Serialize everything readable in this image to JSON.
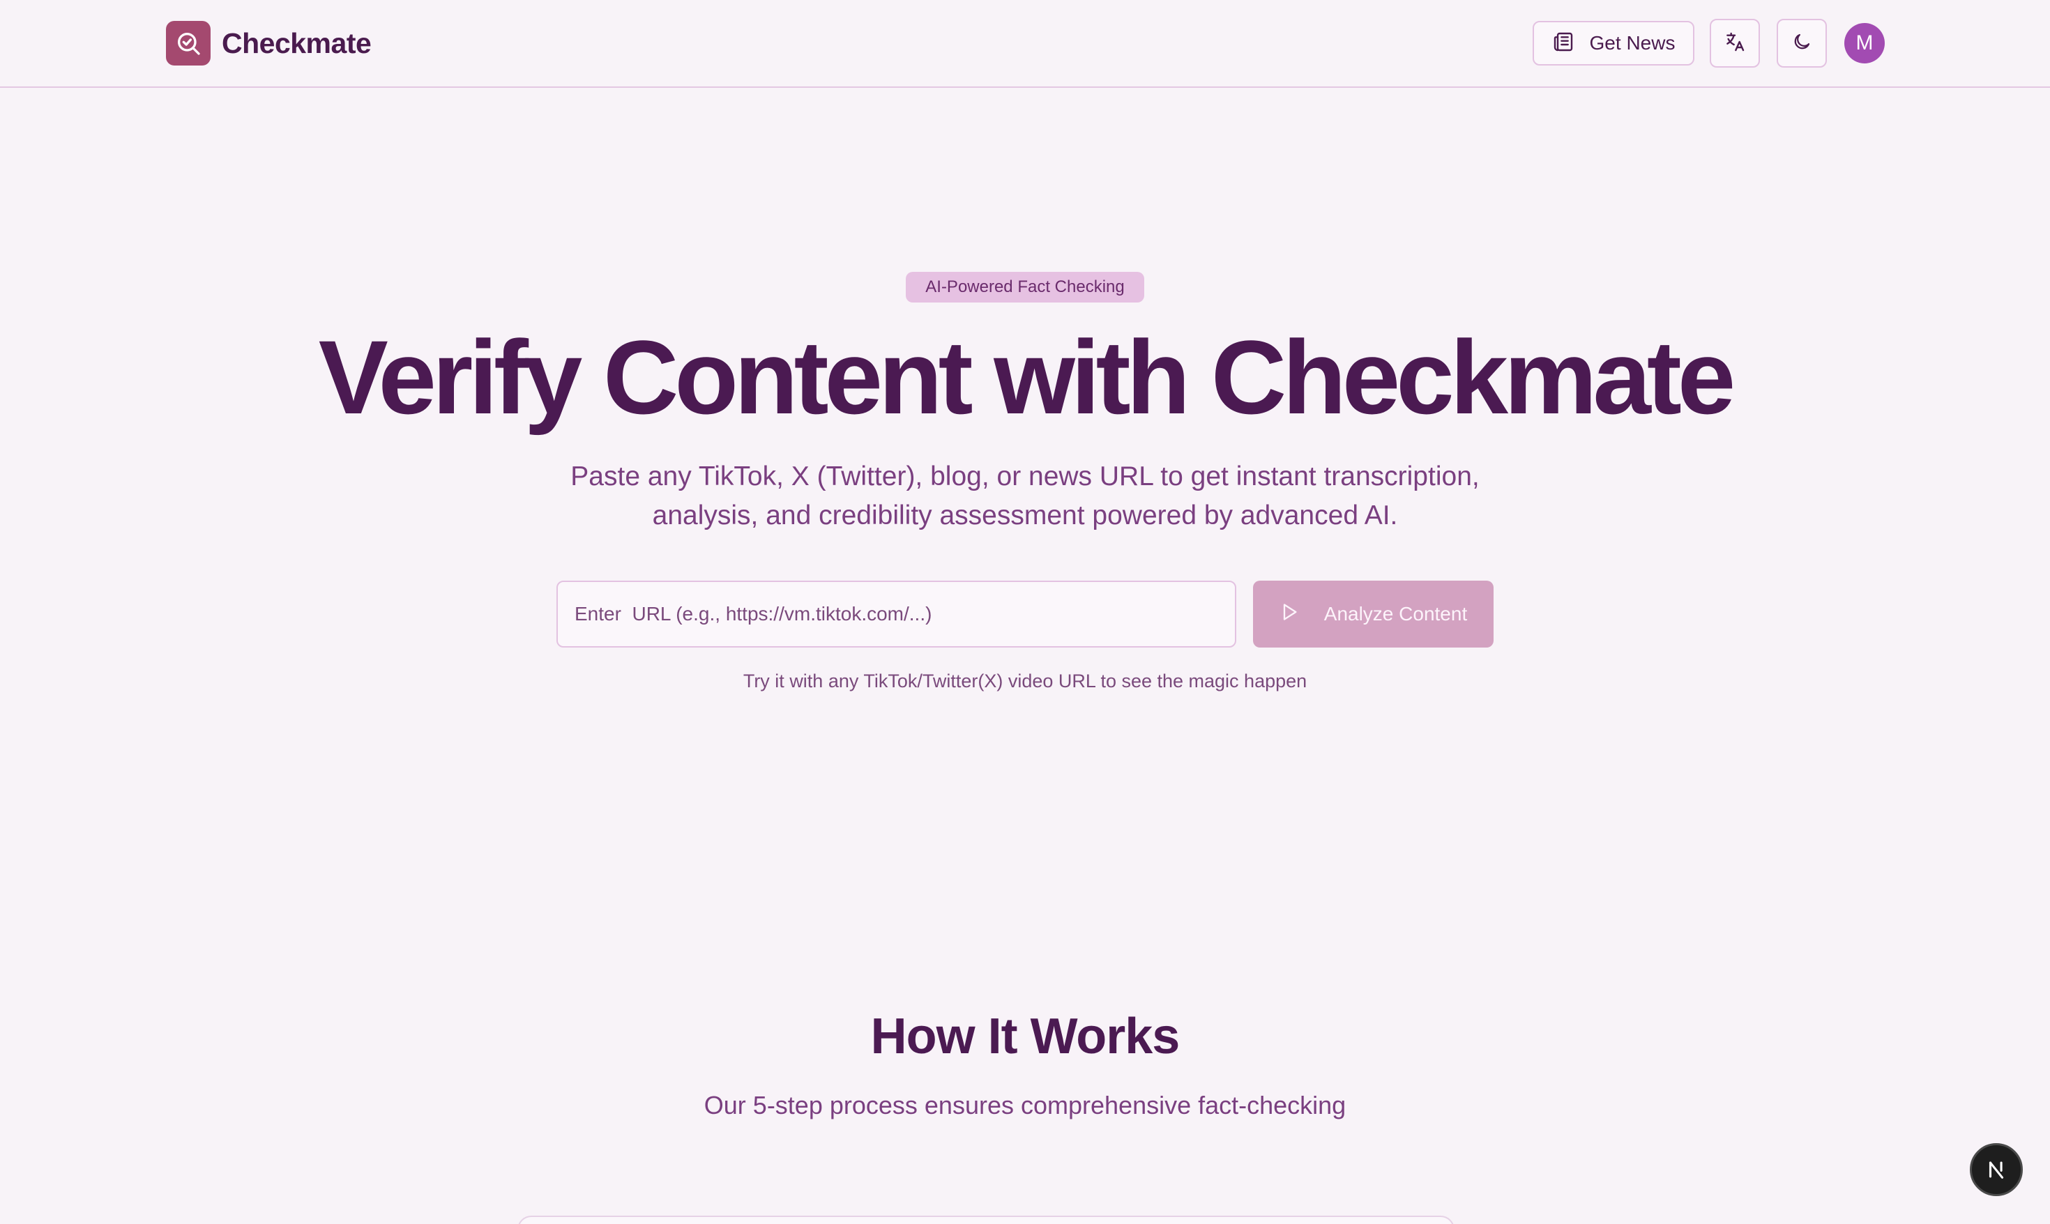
{
  "header": {
    "brand": "Checkmate",
    "get_news_label": "Get News",
    "avatar_initial": "M"
  },
  "hero": {
    "badge": "AI-Powered Fact Checking",
    "title": "Verify Content with Checkmate",
    "subtitle": "Paste any TikTok, X (Twitter), blog, or news URL to get instant transcription, analysis, and credibility assessment powered by advanced AI.",
    "url_input": {
      "placeholder": "Enter  URL (e.g., https://vm.tiktok.com/...)",
      "value": ""
    },
    "analyze_label": "Analyze Content",
    "hint": "Try it with any TikTok/Twitter(X) video URL to see the magic happen"
  },
  "how_it_works": {
    "title": "How It Works",
    "subtitle": "Our 5-step process ensures comprehensive fact-checking"
  },
  "icons": {
    "logo": "search-check-icon",
    "news": "newspaper-icon",
    "translate": "translate-icon",
    "theme": "moon-icon",
    "analyze": "play-icon",
    "dev_badge": "next-logo-icon"
  },
  "colors": {
    "brand": "#a4496f",
    "heading": "#4b1a52",
    "badge_bg": "#e6c1e2",
    "button_bg": "#d3a2c1",
    "avatar_bg": "#a24bb2"
  }
}
